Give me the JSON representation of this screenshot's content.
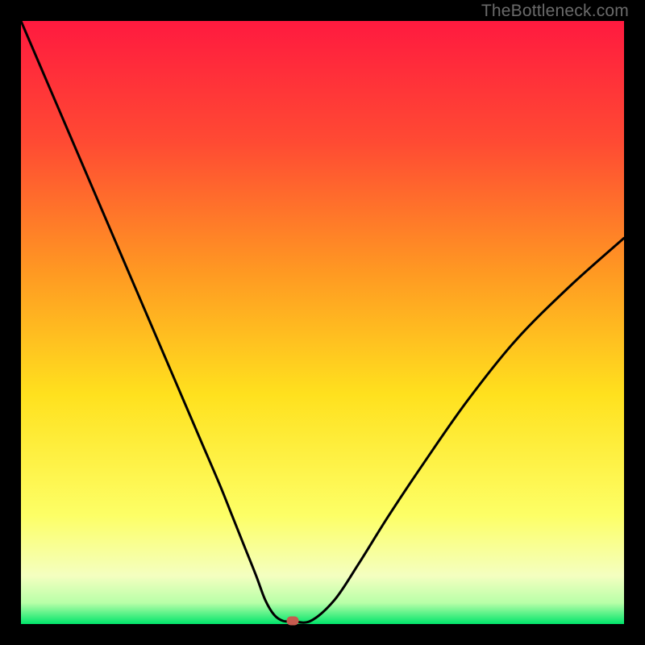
{
  "watermark": "TheBottleneck.com",
  "chart_data": {
    "type": "line",
    "title": "",
    "xlabel": "",
    "ylabel": "",
    "xlim": [
      0,
      100
    ],
    "ylim": [
      0,
      100
    ],
    "series": [
      {
        "name": "bottleneck-curve",
        "x": [
          0,
          3,
          6,
          9,
          12,
          15,
          18,
          21,
          24,
          27,
          30,
          33,
          35,
          37,
          39,
          40.5,
          42,
          43.5,
          45,
          48,
          52,
          56,
          61,
          67,
          74,
          82,
          91,
          100
        ],
        "y": [
          100,
          93,
          86,
          79,
          72,
          65,
          58,
          51,
          44,
          37,
          30,
          23,
          18,
          13,
          8,
          4,
          1.5,
          0.5,
          0.5,
          0.5,
          4,
          10,
          18,
          27,
          37,
          47,
          56,
          64
        ]
      }
    ],
    "marker": {
      "x": 45,
      "y": 0.5,
      "label": "optimal-point"
    },
    "background_gradient": {
      "stops": [
        {
          "offset": 0.0,
          "color": "#ff1a3f"
        },
        {
          "offset": 0.2,
          "color": "#ff4a33"
        },
        {
          "offset": 0.42,
          "color": "#ff9a22"
        },
        {
          "offset": 0.62,
          "color": "#ffe11e"
        },
        {
          "offset": 0.82,
          "color": "#fdff66"
        },
        {
          "offset": 0.92,
          "color": "#f4ffc0"
        },
        {
          "offset": 0.965,
          "color": "#b8ffa8"
        },
        {
          "offset": 1.0,
          "color": "#00e56a"
        }
      ]
    }
  }
}
